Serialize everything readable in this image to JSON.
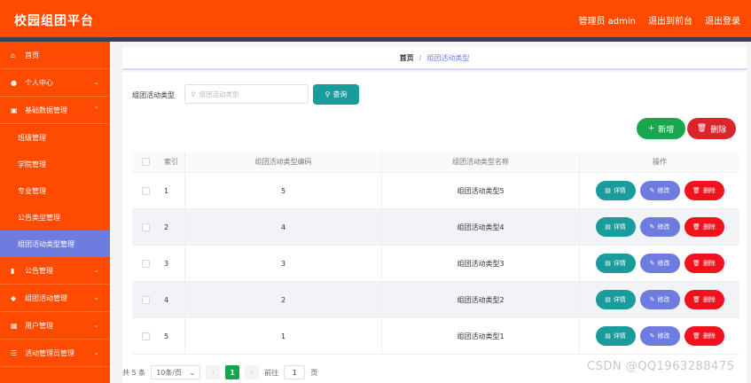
{
  "header": {
    "title": "校园组团平台",
    "admin": "管理员 admin",
    "back_to_front": "退出到前台",
    "logout": "退出登录"
  },
  "sidebar": {
    "items": [
      {
        "label": "首页",
        "icon": "home-icon"
      },
      {
        "label": "个人中心",
        "icon": "user-icon"
      },
      {
        "label": "基础数据管理",
        "icon": "database-icon"
      },
      {
        "label": "班级管理"
      },
      {
        "label": "学院管理"
      },
      {
        "label": "专业管理"
      },
      {
        "label": "公告类型管理"
      },
      {
        "label": "组团活动类型管理"
      },
      {
        "label": "公告管理",
        "icon": "chart-icon"
      },
      {
        "label": "组团活动管理",
        "icon": "shield-icon"
      },
      {
        "label": "用户管理",
        "icon": "grid-icon"
      },
      {
        "label": "活动管理员管理",
        "icon": "list-icon"
      }
    ]
  },
  "breadcrumb": {
    "home": "首页",
    "sep": "/",
    "current": "组团活动类型"
  },
  "search": {
    "label": "组团活动类型",
    "placeholder": "组团活动类型",
    "query_label": "查询"
  },
  "actions": {
    "add_label": "新增",
    "delete_label": "删除"
  },
  "table": {
    "headers": {
      "index": "索引",
      "code": "组团活动类型编码",
      "name": "组团活动类型名称",
      "ops": "操作"
    },
    "rows": [
      {
        "index": "1",
        "code": "5",
        "name": "组团活动类型5"
      },
      {
        "index": "2",
        "code": "4",
        "name": "组团活动类型4"
      },
      {
        "index": "3",
        "code": "3",
        "name": "组团活动类型3"
      },
      {
        "index": "4",
        "code": "2",
        "name": "组团活动类型2"
      },
      {
        "index": "5",
        "code": "1",
        "name": "组团活动类型1"
      }
    ],
    "ops": {
      "detail": "详情",
      "edit": "修改",
      "delete": "删除"
    }
  },
  "pagination": {
    "total": "共 5 条",
    "page_size": "10条/页",
    "current_page": "1",
    "goto_label": "前往",
    "goto_value": "1",
    "page_suffix": "页"
  },
  "watermark": "CSDN @QQ1963288475",
  "colors": {
    "brand": "#ff4a00",
    "active": "#6e7ce0",
    "teal": "#1a9b9c",
    "green": "#18a84b",
    "red": "#f0121c"
  }
}
